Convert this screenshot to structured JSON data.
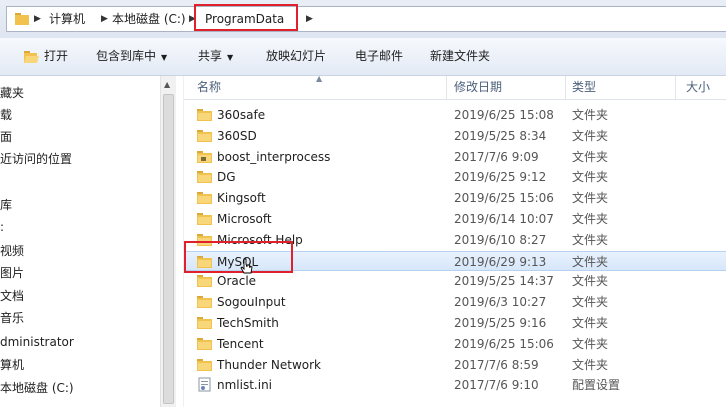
{
  "address": {
    "crumbs": [
      "计算机",
      "本地磁盘 (C:)",
      "ProgramData"
    ]
  },
  "toolbar": {
    "open": "打开",
    "include_in_library": "包含到库中",
    "share": "共享",
    "slideshow": "放映幻灯片",
    "email": "电子邮件",
    "new_folder": "新建文件夹"
  },
  "nav": {
    "items": [
      "收藏夹",
      "下载",
      "桌面",
      "最近访问的位置",
      "库",
      "视频",
      "图片",
      "文档",
      "音乐",
      "Administrator",
      "计算机",
      "本地磁盘 (C:)"
    ],
    "visible_text": [
      "藏夹",
      "载",
      "面",
      "近访问的位置",
      "",
      "",
      "视频",
      "图片",
      "文档",
      "音乐",
      "dministrator",
      "算机",
      "本地磁盘 (C:)"
    ]
  },
  "columns": {
    "name": "名称",
    "date": "修改日期",
    "type": "类型",
    "size": "大小"
  },
  "files": [
    {
      "name": "360safe",
      "date": "2019/6/25 15:08",
      "type": "文件夹",
      "icon": "folder-icon"
    },
    {
      "name": "360SD",
      "date": "2019/5/25 8:34",
      "type": "文件夹",
      "icon": "folder-icon"
    },
    {
      "name": "boost_interprocess",
      "date": "2017/7/6 9:09",
      "type": "文件夹",
      "icon": "folder-lock-icon"
    },
    {
      "name": "DG",
      "date": "2019/6/25 9:12",
      "type": "文件夹",
      "icon": "folder-icon"
    },
    {
      "name": "Kingsoft",
      "date": "2019/6/25 15:06",
      "type": "文件夹",
      "icon": "folder-icon"
    },
    {
      "name": "Microsoft",
      "date": "2019/6/14 10:07",
      "type": "文件夹",
      "icon": "folder-icon"
    },
    {
      "name": "Microsoft Help",
      "date": "2019/6/10 8:27",
      "type": "文件夹",
      "icon": "folder-icon"
    },
    {
      "name": "MySQL",
      "date": "2019/6/29 9:13",
      "type": "文件夹",
      "icon": "folder-icon",
      "selected": true
    },
    {
      "name": "Oracle",
      "date": "2019/5/25 14:37",
      "type": "文件夹",
      "icon": "folder-icon"
    },
    {
      "name": "SogouInput",
      "date": "2019/6/3 10:27",
      "type": "文件夹",
      "icon": "folder-icon"
    },
    {
      "name": "TechSmith",
      "date": "2019/5/25 9:16",
      "type": "文件夹",
      "icon": "folder-icon"
    },
    {
      "name": "Tencent",
      "date": "2019/6/25 15:06",
      "type": "文件夹",
      "icon": "folder-icon"
    },
    {
      "name": "Thunder Network",
      "date": "2017/7/6 8:59",
      "type": "文件夹",
      "icon": "folder-icon"
    },
    {
      "name": "nmlist.ini",
      "date": "2017/7/6 9:10",
      "type": "配置设置",
      "icon": "ini-file-icon"
    }
  ],
  "colors": {
    "highlight": "#e0202a",
    "folder": "#f2c24f",
    "selection": "#d7e7fa"
  }
}
